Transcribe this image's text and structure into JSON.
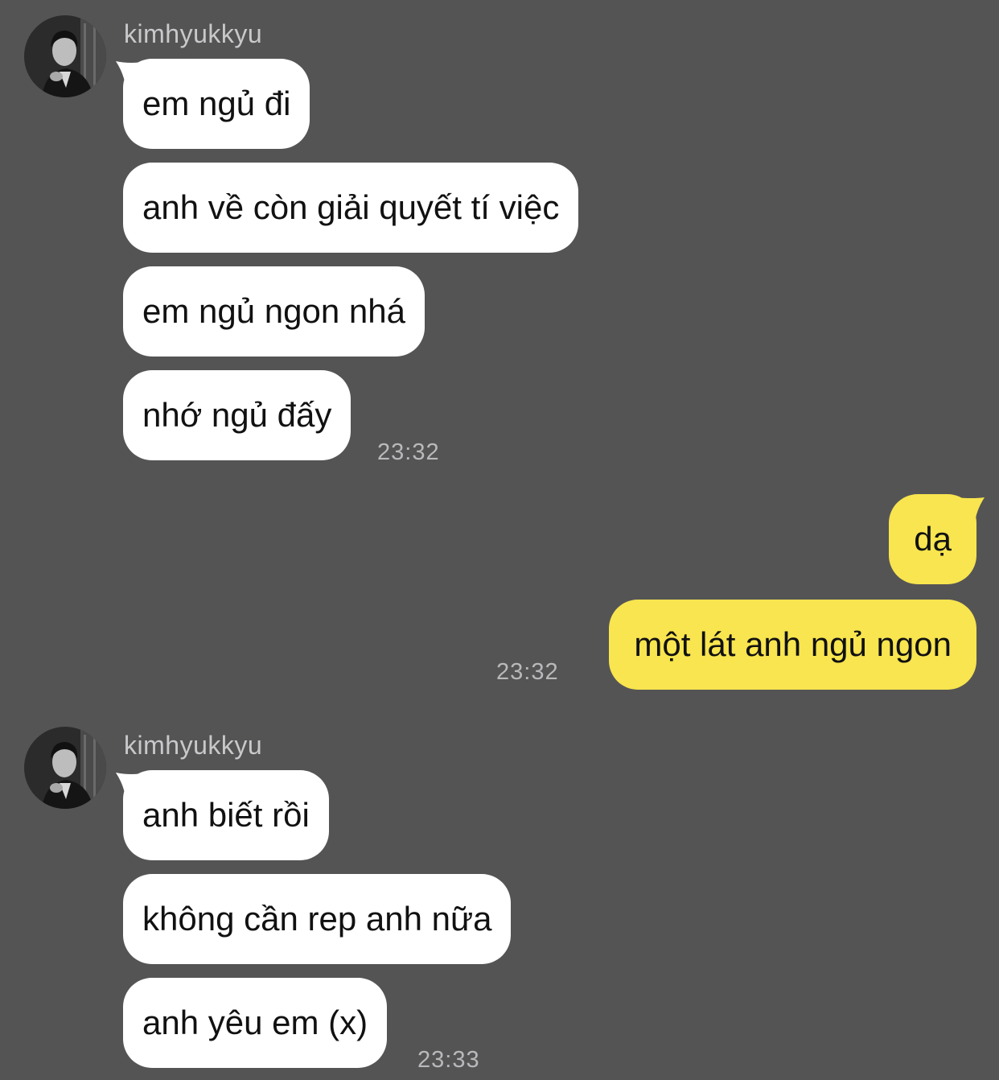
{
  "colors": {
    "background": "#555455",
    "incoming_bubble": "#ffffff",
    "outgoing_bubble": "#f8e54f",
    "sender_name": "#c9c9cb",
    "timestamp": "#b9b9bc"
  },
  "groups": [
    {
      "sender": "kimhyukkyu",
      "avatar_icon": "profile-photo-avatar",
      "messages": [
        "em ngủ đi",
        "anh về còn giải quyết tí việc",
        "em ngủ ngon nhá",
        "nhớ ngủ đấy"
      ],
      "time": "23:32"
    },
    {
      "sender": "me",
      "messages": [
        "dạ",
        "một lát anh ngủ ngon"
      ],
      "time": "23:32"
    },
    {
      "sender": "kimhyukkyu",
      "avatar_icon": "profile-photo-avatar",
      "messages": [
        "anh biết rồi",
        "không cần rep anh nữa",
        "anh yêu em (x)"
      ],
      "time": "23:33"
    }
  ]
}
